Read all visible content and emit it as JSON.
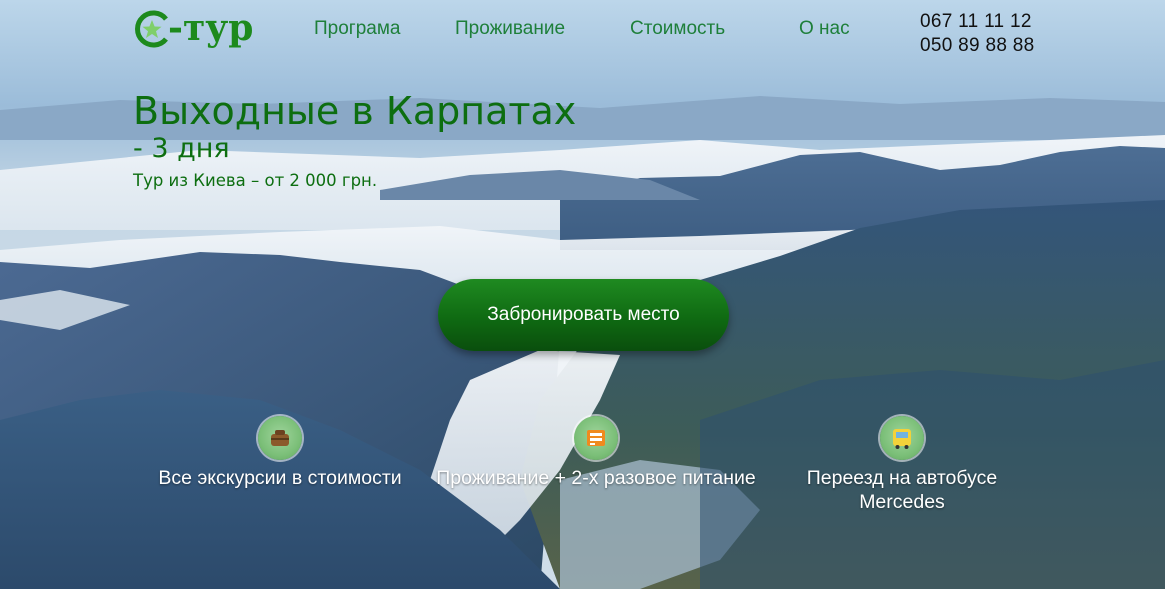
{
  "brand": {
    "logo_text": "-тур",
    "logo_color": "#1d8a1d"
  },
  "nav": {
    "items": [
      "Програма",
      "Проживание",
      "Стоимость",
      "О нас"
    ],
    "color": "#1e7f3a"
  },
  "contacts": {
    "phones": [
      "067 11 11 12",
      "050 89 88 88"
    ]
  },
  "hero": {
    "title": "Выходные в Карпатах",
    "duration": "- 3 дня",
    "tour_line": "Тур из Киева – от 2 000 грн.",
    "cta_label": "Забронировать место",
    "title_color": "#0d6e10"
  },
  "features": [
    {
      "icon": "excursion-icon",
      "text": "Все экскурсии в стоимости"
    },
    {
      "icon": "food-icon",
      "text": "Проживание + 2-х разовое питание"
    },
    {
      "icon": "bus-icon",
      "text": "Переезд на автобусе Mercedes"
    }
  ]
}
